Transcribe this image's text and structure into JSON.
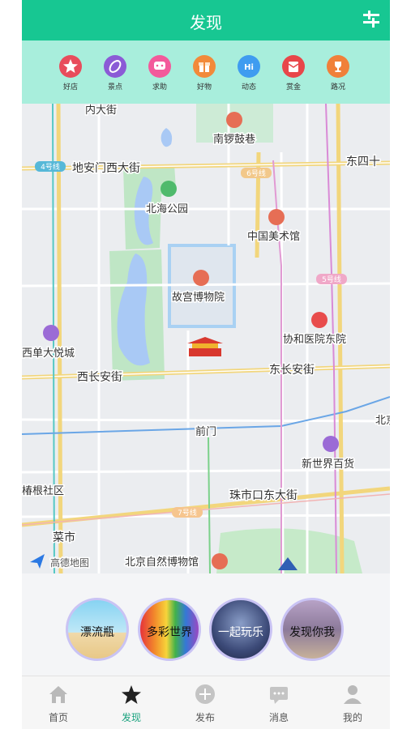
{
  "header": {
    "title": "发现"
  },
  "categories": [
    {
      "label": "好店",
      "color": "#e84c5c",
      "icon": "star-icon"
    },
    {
      "label": "景点",
      "color": "#8b5bd6",
      "icon": "leaf-icon"
    },
    {
      "label": "求助",
      "color": "#f35a9b",
      "icon": "chat-icon"
    },
    {
      "label": "好物",
      "color": "#f28a3a",
      "icon": "gift-icon"
    },
    {
      "label": "动态",
      "color": "#3f9cf0",
      "icon": "hi-icon"
    },
    {
      "label": "赏金",
      "color": "#e8464a",
      "icon": "envelope-icon"
    },
    {
      "label": "路况",
      "color": "#f0803a",
      "icon": "trophy-icon"
    }
  ],
  "map": {
    "labels": {
      "nanluoguxiang": "南锣鼓巷",
      "dianmenxi": "地安门西大街",
      "dongsi": "东四十",
      "line4": "4号线",
      "line6": "6号线",
      "line5": "5号线",
      "line7": "7号线",
      "beihai": "北海公园",
      "meishuguan": "中国美术馆",
      "gugong": "故宫博物院",
      "xiehe": "协和医院东院",
      "xidan": "西单大悦城",
      "xichangan": "西长安街",
      "dongchangan": "东长安街",
      "qianmen": "前门",
      "xinshijie": "新世界百货",
      "zhushikou": "珠市口东大街",
      "shequ": "椿根社区",
      "caishi": "菜市",
      "ziran": "北京自然博物馆",
      "gaode": "高德地图",
      "beijing": "北京",
      "neida": "内大街"
    }
  },
  "bubbles": [
    {
      "label": "漂流瓶"
    },
    {
      "label": "多彩世界"
    },
    {
      "label": "一起玩乐"
    },
    {
      "label": "发现你我"
    }
  ],
  "tabs": [
    {
      "label": "首页",
      "active": false
    },
    {
      "label": "发现",
      "active": true
    },
    {
      "label": "发布",
      "active": false
    },
    {
      "label": "消息",
      "active": false
    },
    {
      "label": "我的",
      "active": false
    }
  ],
  "colors": {
    "brand": "#17c792",
    "catbar": "#a8eedc",
    "active_tab": "#1aa27e"
  }
}
